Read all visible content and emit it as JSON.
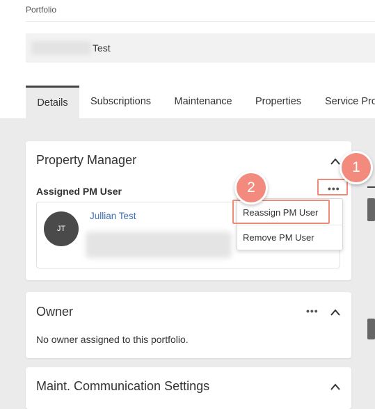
{
  "breadcrumb": "Portfolio",
  "portfolio_name": "Test",
  "tabs": [
    {
      "label": "Details",
      "active": true
    },
    {
      "label": "Subscriptions"
    },
    {
      "label": "Maintenance"
    },
    {
      "label": "Properties"
    },
    {
      "label": "Service Pro"
    }
  ],
  "property_manager": {
    "title": "Property Manager",
    "subheading": "Assigned PM User",
    "user_initials": "JT",
    "user_name": "Jullian Test",
    "more_icon": "ellipsis-icon",
    "collapse_icon": "chevron-up-icon"
  },
  "pm_menu": {
    "items": [
      "Reassign PM User",
      "Remove PM User"
    ]
  },
  "owner": {
    "title": "Owner",
    "empty_message": "No owner assigned to this portfolio."
  },
  "maint_settings": {
    "title": "Maint. Communication Settings"
  },
  "callouts": [
    "1",
    "2"
  ],
  "colors": {
    "callout": "#f28b7e",
    "link": "#3d6fb4",
    "tab_active_border": "#444444",
    "page_bg": "#ebebeb"
  }
}
